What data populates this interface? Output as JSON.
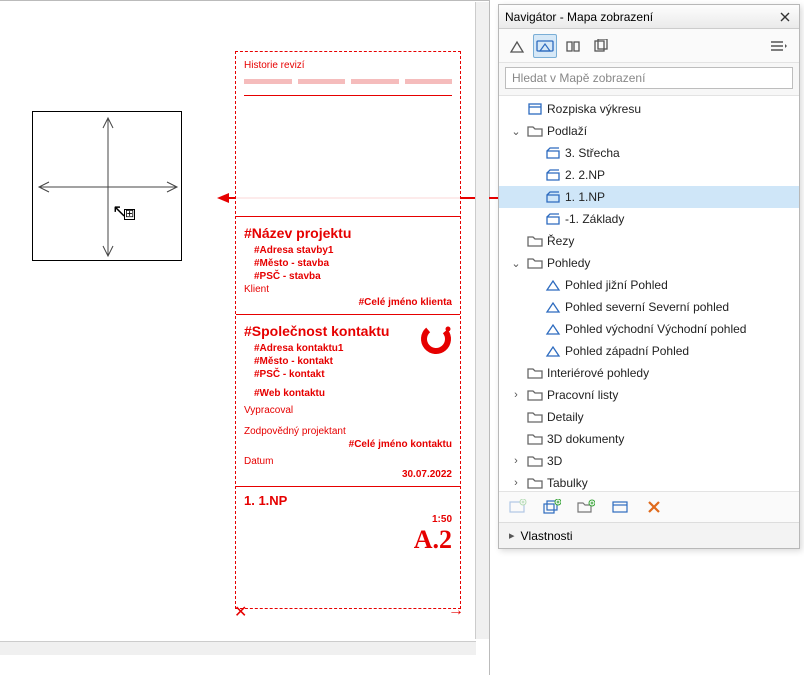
{
  "navigator": {
    "title": "Navigátor - Mapa zobrazení",
    "search_placeholder": "Hledat v Mapě zobrazení",
    "props_label": "Vlastnosti",
    "toolbar_icons": {
      "project_map": "project-map-icon",
      "view_map": "view-map-icon",
      "layout_book": "layout-book-icon",
      "publisher": "publisher-icon",
      "menu": "panel-menu-icon"
    },
    "action_icons": {
      "new_view": "new-view-icon",
      "clone_view": "clone-view-icon",
      "new_folder": "new-folder-icon",
      "settings": "view-settings-icon",
      "delete": "delete-icon"
    },
    "tree": [
      {
        "depth": 0,
        "expander": "",
        "icon": "book",
        "label": "Rozpiska výkresu"
      },
      {
        "depth": 0,
        "expander": "v",
        "icon": "folder",
        "label": "Podlaží"
      },
      {
        "depth": 1,
        "expander": "",
        "icon": "floor",
        "label": "3. Střecha"
      },
      {
        "depth": 1,
        "expander": "",
        "icon": "floor",
        "label": "2. 2.NP"
      },
      {
        "depth": 1,
        "expander": "",
        "icon": "floor",
        "label": "1. 1.NP",
        "selected": true
      },
      {
        "depth": 1,
        "expander": "",
        "icon": "floor",
        "label": "-1. Základy"
      },
      {
        "depth": 0,
        "expander": "",
        "icon": "folder",
        "label": "Řezy"
      },
      {
        "depth": 0,
        "expander": "v",
        "icon": "folder",
        "label": "Pohledy"
      },
      {
        "depth": 1,
        "expander": "",
        "icon": "elev",
        "label": "Pohled jižní Pohled"
      },
      {
        "depth": 1,
        "expander": "",
        "icon": "elev",
        "label": "Pohled severní Severní pohled"
      },
      {
        "depth": 1,
        "expander": "",
        "icon": "elev",
        "label": "Pohled východní Východní pohled"
      },
      {
        "depth": 1,
        "expander": "",
        "icon": "elev",
        "label": "Pohled západní Pohled"
      },
      {
        "depth": 0,
        "expander": "",
        "icon": "folder",
        "label": "Interiérové pohledy"
      },
      {
        "depth": 0,
        "expander": ">",
        "icon": "folder",
        "label": "Pracovní listy"
      },
      {
        "depth": 0,
        "expander": "",
        "icon": "folder",
        "label": "Detaily"
      },
      {
        "depth": 0,
        "expander": "",
        "icon": "folder",
        "label": "3D dokumenty"
      },
      {
        "depth": 0,
        "expander": ">",
        "icon": "folder",
        "label": "3D"
      },
      {
        "depth": 0,
        "expander": ">",
        "icon": "folder",
        "label": "Tabulky"
      }
    ]
  },
  "titleblock": {
    "history_label": "Historie revizí",
    "project_name": "#Název projektu",
    "addr1": "#Adresa stavby1",
    "addr2": "#Město - stavba",
    "addr3": "#PSČ - stavba",
    "client_label": "Klient",
    "client_name": "#Celé jméno klienta",
    "company": "#Společnost kontaktu",
    "caddr1": "#Adresa kontaktu1",
    "caddr2": "#Město - kontakt",
    "caddr3": "#PSČ - kontakt",
    "cweb": "#Web kontaktu",
    "drawn_label": "Vypracoval",
    "resp_label": "Zodpovědný projektant",
    "resp_name": "#Celé jméno kontaktu",
    "date_label": "Datum",
    "date_value": "30.07.2022",
    "drawing_name": "1. 1.NP",
    "scale": "1:50",
    "sheet": "A.2"
  }
}
